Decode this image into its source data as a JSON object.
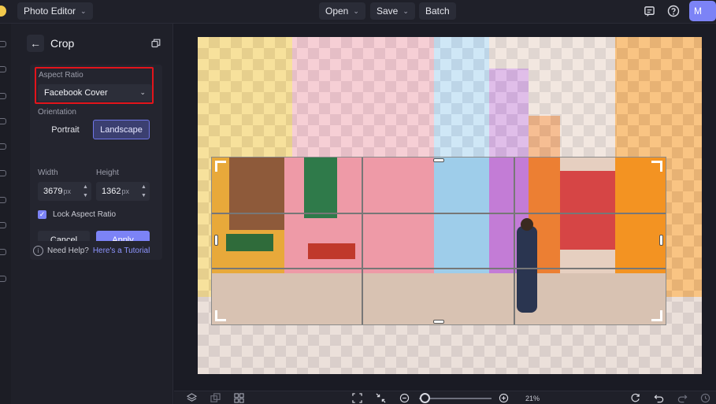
{
  "topbar": {
    "app_menu_label": "Photo Editor",
    "open_label": "Open",
    "save_label": "Save",
    "batch_label": "Batch",
    "avatar_initial": "M"
  },
  "panel": {
    "title": "Crop",
    "aspect_ratio_label": "Aspect Ratio",
    "aspect_ratio_value": "Facebook Cover",
    "orientation_label": "Orientation",
    "orientation_options": [
      "Portrait",
      "Landscape"
    ],
    "orientation_selected": "Landscape",
    "width_label": "Width",
    "height_label": "Height",
    "width_value": "3679",
    "height_value": "1362",
    "unit": "px",
    "lock_label": "Lock Aspect Ratio",
    "lock_checked": true,
    "cancel_label": "Cancel",
    "apply_label": "Apply",
    "help_text": "Need Help?",
    "help_link": "Here's a Tutorial"
  },
  "bottombar": {
    "zoom_percent": "21%",
    "zoom_fraction": 0.05
  },
  "colors": {
    "accent": "#7c83f6",
    "highlight_border": "#e3141b",
    "background": "#1a1b24"
  },
  "icons": {
    "comment": "comment-icon",
    "help": "help-circle-icon",
    "back": "arrow-left-icon",
    "copy": "copy-icon",
    "layers": "layers-icon",
    "fit": "fit-screen-icon",
    "undo": "undo-icon",
    "redo": "redo-icon",
    "history": "history-icon"
  }
}
